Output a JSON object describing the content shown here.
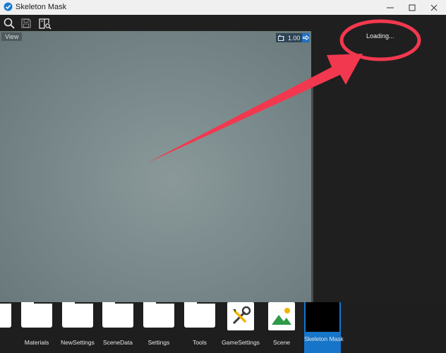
{
  "window": {
    "title": "Skeleton Mask",
    "minimize_glyph": "—",
    "maximize_glyph": "☐",
    "close_glyph": "✕"
  },
  "toolbar": {
    "icons": [
      "search-icon",
      "save-icon",
      "book-search-icon"
    ]
  },
  "viewport": {
    "label": "View",
    "zoom_value": "1.00"
  },
  "side_panel": {
    "status": "Loading..."
  },
  "assets": [
    {
      "label": "Materials",
      "kind": "folder"
    },
    {
      "label": "NewSettings",
      "kind": "folder"
    },
    {
      "label": "SceneData",
      "kind": "folder"
    },
    {
      "label": "Settings",
      "kind": "folder"
    },
    {
      "label": "Tools",
      "kind": "folder"
    },
    {
      "label": "GameSettings",
      "kind": "settings-doc"
    },
    {
      "label": "Scene",
      "kind": "scene-doc"
    },
    {
      "label": "Skeleton Mask",
      "kind": "selected"
    }
  ],
  "colors": {
    "accent": "#1675c9",
    "annotation": "#f2384f"
  }
}
